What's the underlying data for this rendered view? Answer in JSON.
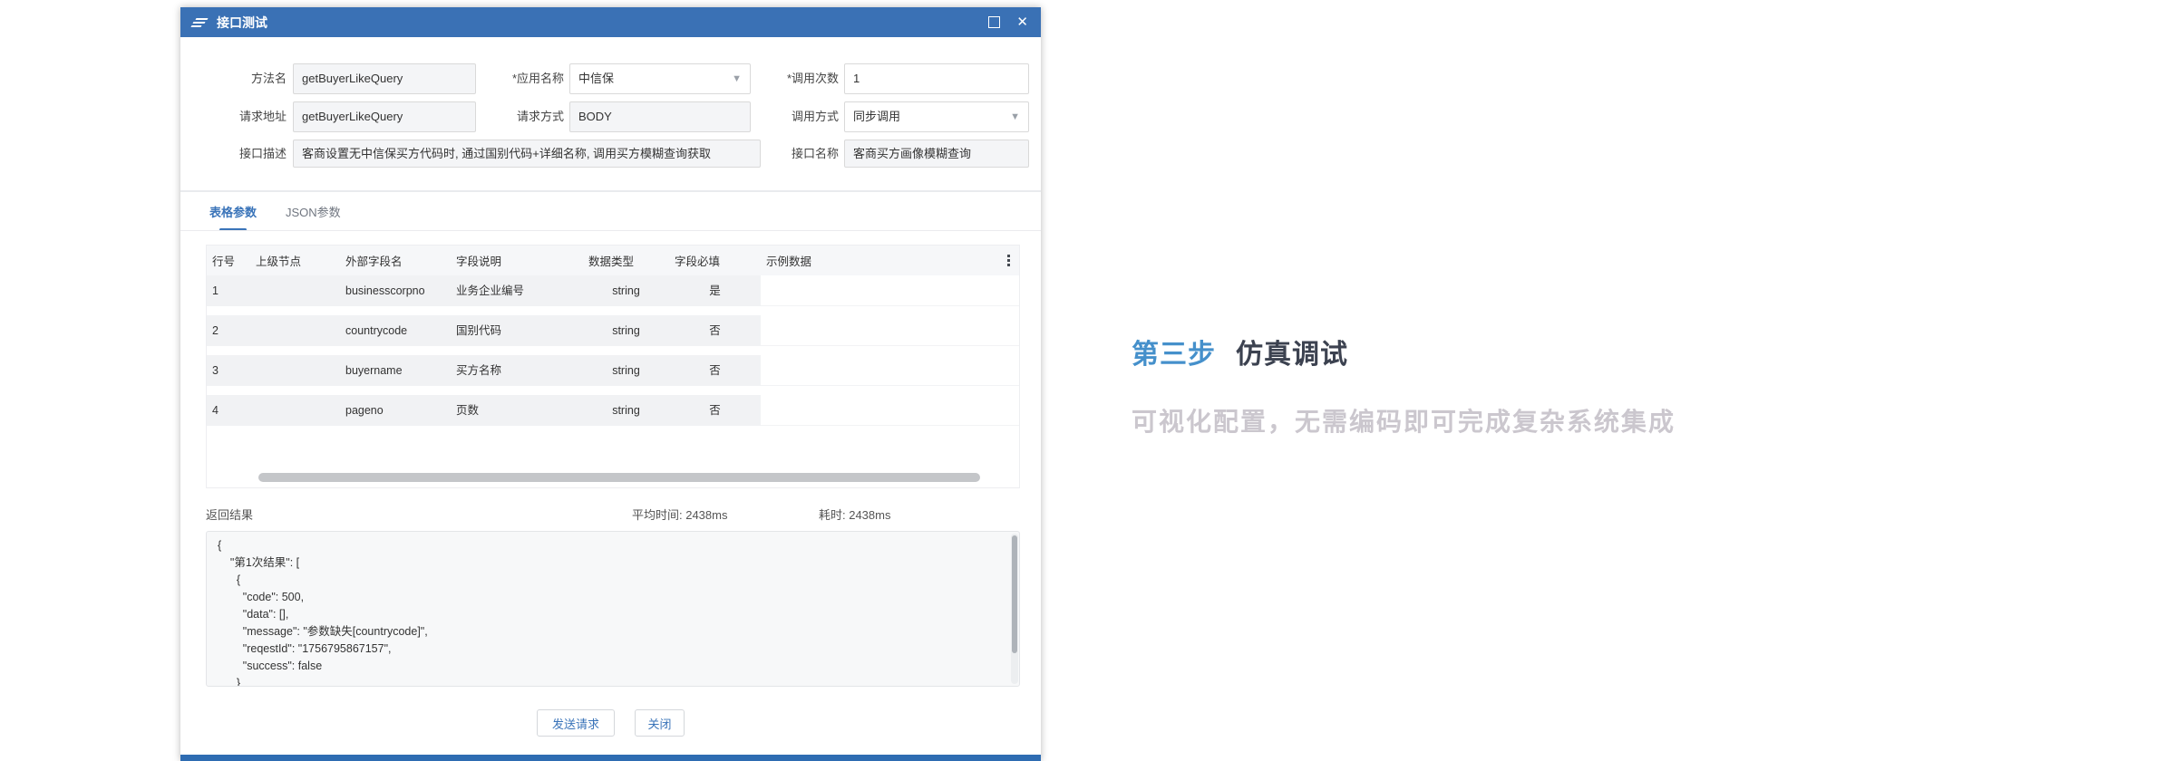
{
  "dialog": {
    "title": "接口测试",
    "window": {
      "maximize_icon": "maximize-square",
      "close_icon": "✕"
    },
    "form": {
      "method_name": {
        "label": "方法名",
        "value": "getBuyerLikeQuery"
      },
      "app_name": {
        "label": "*应用名称",
        "value": "中信保",
        "arrow": "▼"
      },
      "call_count": {
        "label": "*调用次数",
        "value": "1"
      },
      "request_url": {
        "label": "请求地址",
        "value": "getBuyerLikeQuery"
      },
      "request_method": {
        "label": "请求方式",
        "value": "BODY"
      },
      "call_mode": {
        "label": "调用方式",
        "value": "同步调用",
        "arrow": "▼"
      },
      "api_desc": {
        "label": "接口描述",
        "value": "客商设置无中信保买方代码时, 通过国别代码+详细名称, 调用买方模糊查询获取"
      },
      "api_name": {
        "label": "接口名称",
        "value": "客商买方画像模糊查询"
      }
    },
    "tabs": {
      "table_params": "表格参数",
      "json_params": "JSON参数"
    },
    "table": {
      "headers": [
        "行号",
        "上级节点",
        "外部字段名",
        "字段说明",
        "数据类型",
        "字段必填",
        "示例数据"
      ],
      "rows": [
        [
          "1",
          "",
          "businesscorpno",
          "业务企业编号",
          "string",
          "是",
          ""
        ],
        [
          "2",
          "",
          "countrycode",
          "国别代码",
          "string",
          "否",
          ""
        ],
        [
          "3",
          "",
          "buyername",
          "买方名称",
          "string",
          "否",
          ""
        ],
        [
          "4",
          "",
          "pageno",
          "页数",
          "string",
          "否",
          ""
        ]
      ]
    },
    "results": {
      "label": "返回结果",
      "avg_time": "平均时间: 2438ms",
      "cost_time": "耗时: 2438ms",
      "result_text": "{\n    \"第1次结果\": [\n      {\n        \"code\": 500,\n        \"data\": [],\n        \"message\": \"参数缺失[countrycode]\",\n        \"reqestId\": \"1756795867157\",\n        \"success\": false\n      }\n    ]\n}"
    },
    "footer": {
      "send_label": "发送请求",
      "close_label": "关闭"
    }
  },
  "side_text": {
    "step": "第三步",
    "title": "仿真调试",
    "subtitle": "可视化配置，无需编码即可完成复杂系统集成"
  },
  "colors": {
    "titlebar_blue": "#3a71b5",
    "accent_blue": "#3a74b9",
    "step_blue": "#4590cb",
    "bottom_strip_blue": "#2e6cb2"
  }
}
